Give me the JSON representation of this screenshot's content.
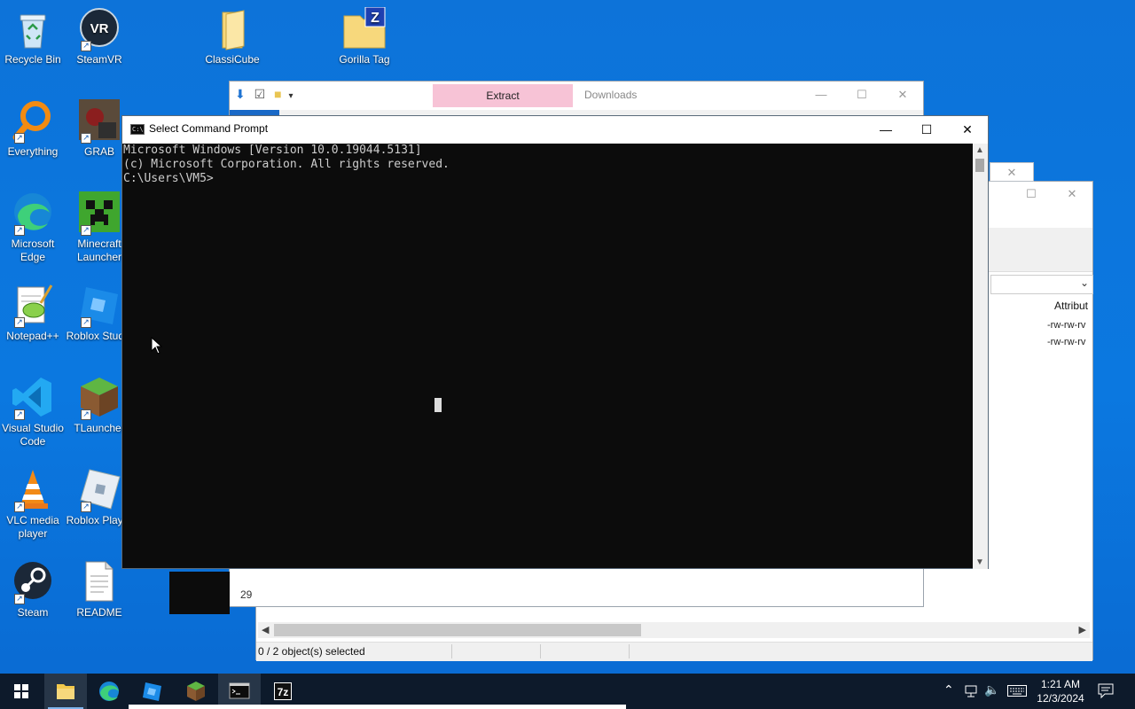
{
  "desktop": {
    "icons": [
      {
        "label": "Recycle Bin"
      },
      {
        "label": "SteamVR"
      },
      {
        "label": "ClassiCube"
      },
      {
        "label": "Gorilla Tag"
      },
      {
        "label": "Everything"
      },
      {
        "label": "GRAB"
      },
      {
        "label": "Microsoft Edge"
      },
      {
        "label": "Minecraft Launcher"
      },
      {
        "label": "Notepad++"
      },
      {
        "label": "Roblox Studio"
      },
      {
        "label": "Visual Studio Code"
      },
      {
        "label": "TLauncher"
      },
      {
        "label": "VLC media player"
      },
      {
        "label": "Roblox Player"
      },
      {
        "label": "Steam"
      },
      {
        "label": "README"
      }
    ]
  },
  "explorer": {
    "title": "Downloads",
    "extract_tab": "Extract",
    "line_number": "29"
  },
  "sevenzip": {
    "column_header": "Attribut",
    "rows": [
      "-rw-rw-rv",
      "-rw-rw-rv"
    ],
    "status": "0 / 2 object(s) selected"
  },
  "cmd": {
    "title": "Select Command Prompt",
    "lines": [
      "Microsoft Windows [Version 10.0.19044.5131]",
      "(c) Microsoft Corporation. All rights reserved.",
      "",
      "C:\\Users\\VM5>"
    ]
  },
  "taskbar": {
    "time": "1:21 AM",
    "date": "12/3/2024",
    "apps": [
      "start-button",
      "file-explorer",
      "microsoft-edge",
      "roblox-studio",
      "minecraft",
      "command-prompt",
      "7-zip"
    ]
  },
  "colors": {
    "desktop_bg": "#0b78e0",
    "taskbar_bg": "#0d1a2b",
    "console_bg": "#0c0c0c",
    "console_fg": "#cccccc",
    "extract_tab": "#f7c3d6"
  }
}
